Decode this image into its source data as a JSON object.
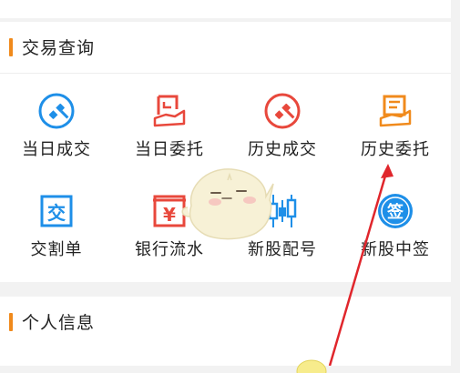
{
  "sections": {
    "trade": {
      "title": "交易查询",
      "items": [
        {
          "label": "当日成交",
          "icon": "hammer-circle-icon",
          "color": "#1e8fe8"
        },
        {
          "label": "当日委托",
          "icon": "hand-document-icon",
          "color": "#e8483c"
        },
        {
          "label": "历史成交",
          "icon": "hammer-circle-icon",
          "color": "#e8483c"
        },
        {
          "label": "历史委托",
          "icon": "hand-document-icon",
          "color": "#f08a1c"
        },
        {
          "label": "交割单",
          "icon": "settlement-icon",
          "color": "#1e8fe8"
        },
        {
          "label": "银行流水",
          "icon": "yen-icon",
          "color": "#e8483c"
        },
        {
          "label": "新股配号",
          "icon": "candlestick-icon",
          "color": "#1e8fe8"
        },
        {
          "label": "新股中签",
          "icon": "sign-icon",
          "color": "#1e8fe8"
        }
      ]
    },
    "personal": {
      "title": "个人信息"
    }
  },
  "colors": {
    "accent": "#f08a1c",
    "blue": "#1e8fe8",
    "red": "#e8483c",
    "arrow": "#e0262c"
  }
}
